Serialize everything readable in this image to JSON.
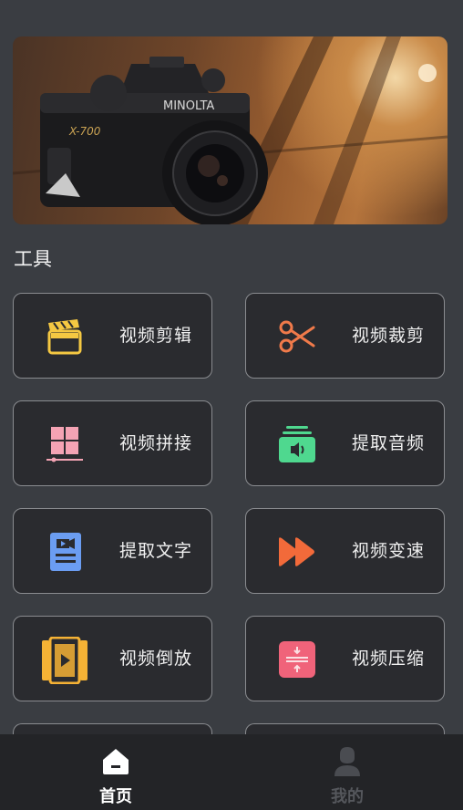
{
  "banner": {
    "image": "camera-photo",
    "camera_brand": "MINOLTA",
    "camera_model": "X-700"
  },
  "section": {
    "title": "工具"
  },
  "tools": [
    {
      "label": "视频剪辑",
      "icon": "clapperboard-icon",
      "color": "#f5c842"
    },
    {
      "label": "视频裁剪",
      "icon": "scissors-icon",
      "color": "#f07a4a"
    },
    {
      "label": "视频拼接",
      "icon": "grid-merge-icon",
      "color": "#f4a3b4"
    },
    {
      "label": "提取音频",
      "icon": "audio-extract-icon",
      "color": "#4fd88f"
    },
    {
      "label": "提取文字",
      "icon": "video-text-icon",
      "color": "#6b9df2"
    },
    {
      "label": "视频变速",
      "icon": "fast-forward-icon",
      "color": "#f26a3a"
    },
    {
      "label": "视频倒放",
      "icon": "film-reverse-icon",
      "color": "#f5b235"
    },
    {
      "label": "视频压缩",
      "icon": "compress-icon",
      "color": "#f0637a"
    }
  ],
  "tabbar": {
    "home_label": "首页",
    "mine_label": "我的"
  }
}
